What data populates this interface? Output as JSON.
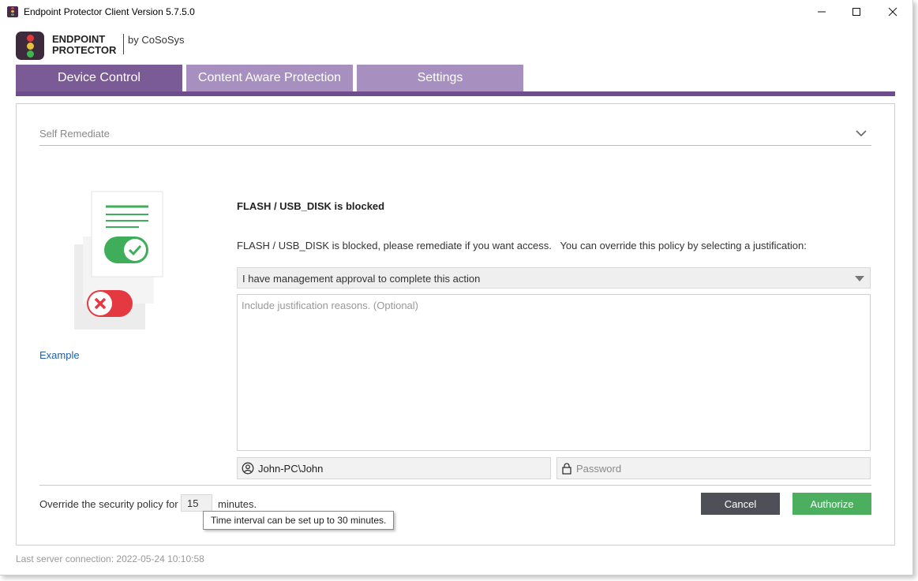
{
  "window": {
    "title": "Endpoint Protector Client Version 5.7.5.0",
    "controls": {
      "minimize": "—",
      "maximize": "☐",
      "close": "✕"
    }
  },
  "logo": {
    "line1": "ENDPOINT",
    "line2": "PROTECTOR",
    "by": "by CoSoSys"
  },
  "tabs": [
    {
      "label": "Device Control",
      "active": true
    },
    {
      "label": "Content Aware Protection",
      "active": false
    },
    {
      "label": "Settings",
      "active": false
    }
  ],
  "section": {
    "title": "Self Remediate",
    "icon": "chevron-down-icon"
  },
  "example_link": "Example",
  "message": {
    "title": "FLASH / USB_DISK is blocked",
    "description": "FLASH / USB_DISK is blocked, please remediate if you want access.   You can override this policy by selecting a justification:"
  },
  "justification": {
    "selected": "I have management approval to complete this action",
    "reasons_placeholder": "Include justification reasons. (Optional)"
  },
  "credentials": {
    "username": "John-PC\\John",
    "password_placeholder": "Password",
    "user_icon": "user-circle-icon",
    "lock_icon": "lock-icon"
  },
  "override": {
    "label": "Override the security policy for",
    "minutes": "15",
    "unit": "minutes.",
    "tooltip": "Time interval can be set up to 30 minutes."
  },
  "buttons": {
    "cancel": "Cancel",
    "authorize": "Authorize"
  },
  "status": "Last server connection: 2022-05-24 10:10:58",
  "colors": {
    "tab_active": "#7b5b96",
    "tab_inactive": "#a78fc0",
    "tab_bar": "#6f4d8c",
    "authorize": "#4caf5f",
    "cancel": "#4f4f57",
    "link": "#2060a8"
  }
}
